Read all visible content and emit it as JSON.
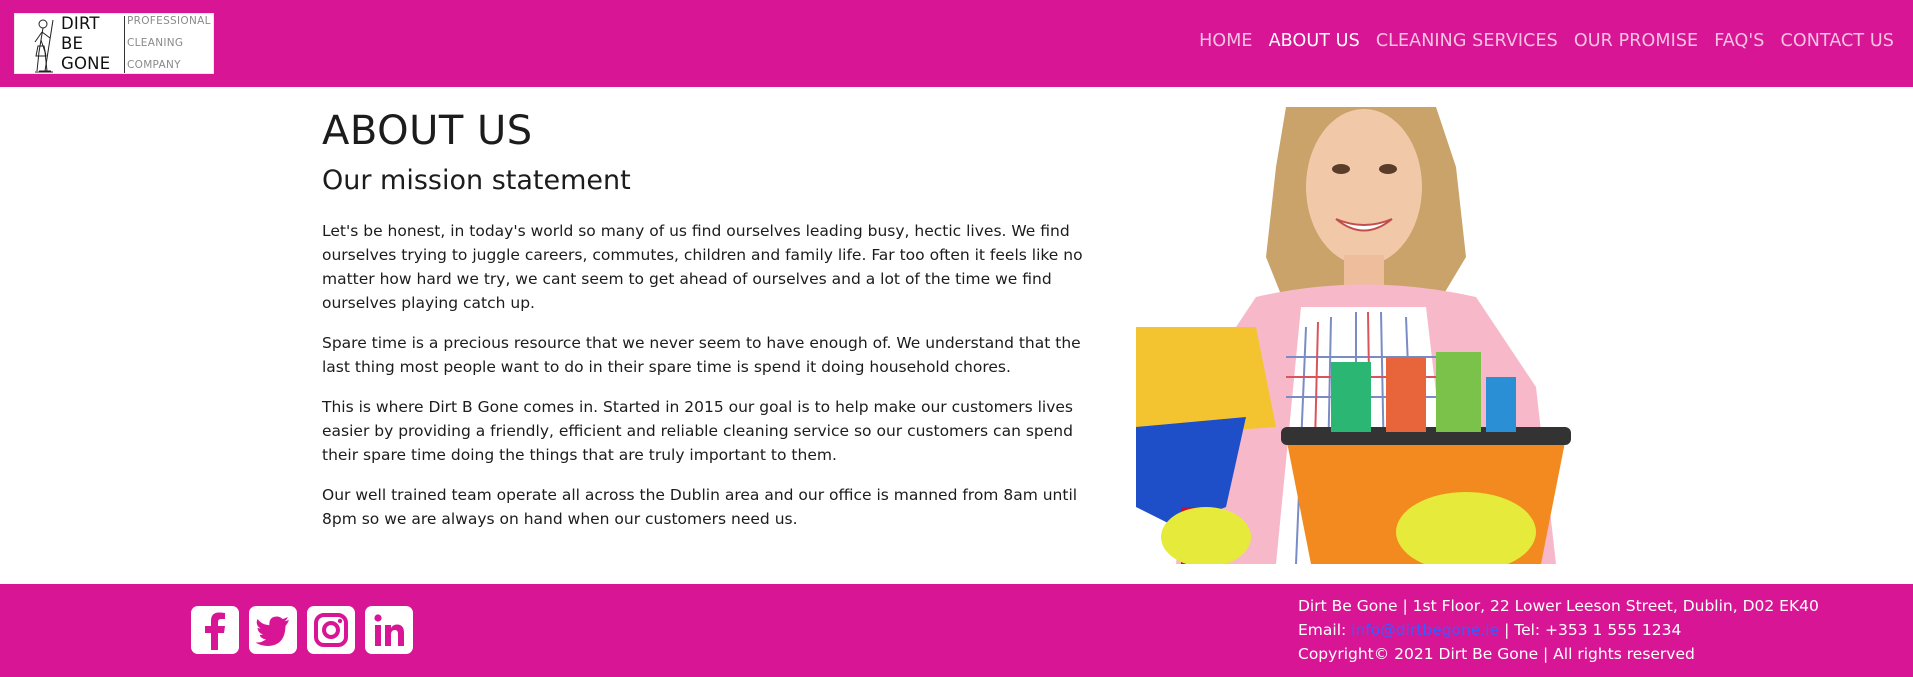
{
  "brand": {
    "word1": "DIRT",
    "word2": "BE",
    "word3": "GONE",
    "sub1": "PROFESSIONAL",
    "sub2": "CLEANING",
    "sub3": "COMPANY"
  },
  "nav": {
    "items": [
      {
        "label": "HOME",
        "active": false
      },
      {
        "label": "ABOUT US",
        "active": true
      },
      {
        "label": "CLEANING SERVICES",
        "active": false
      },
      {
        "label": "OUR PROMISE",
        "active": false
      },
      {
        "label": "FAQ'S",
        "active": false
      },
      {
        "label": "CONTACT US",
        "active": false
      }
    ]
  },
  "main": {
    "title": "ABOUT US",
    "subtitle": "Our mission statement",
    "paragraphs": [
      "Let's be honest, in today's world so many of us find ourselves leading busy, hectic lives. We find ourselves trying to juggle careers, commutes, children and family life. Far too often it feels like no matter how hard we try, we cant seem to get ahead of ourselves and a lot of the time we find ourselves playing catch up.",
      "Spare time is a precious resource that we never seem to have enough of. We understand that the last thing most people want to do in their spare time is spend it doing household chores.",
      "This is where Dirt B Gone comes in. Started in 2015 our goal is to help make our customers lives easier by providing a friendly, efficient and reliable cleaning service so our customers can spend their spare time doing the things that are truly important to them.",
      "Our well trained team operate all across the Dublin area and our office is manned from 8am until 8pm so we are always on hand when our customers need us."
    ]
  },
  "footer": {
    "social": [
      "facebook-icon",
      "twitter-icon",
      "instagram-icon",
      "linkedin-icon"
    ],
    "address": "Dirt Be Gone | 1st Floor, 22 Lower Leeson Street, Dublin, D02 EK40",
    "email_label": "Email: ",
    "email": "info@dirtbegone.ie",
    "tel": " | Tel: +353 1 555 1234",
    "copyright": "Copyright© 2021 Dirt Be Gone | All rights reserved"
  },
  "colors": {
    "brand": "#d81595",
    "nav_inactive": "#f4c3e1",
    "link": "#3a5cff"
  }
}
